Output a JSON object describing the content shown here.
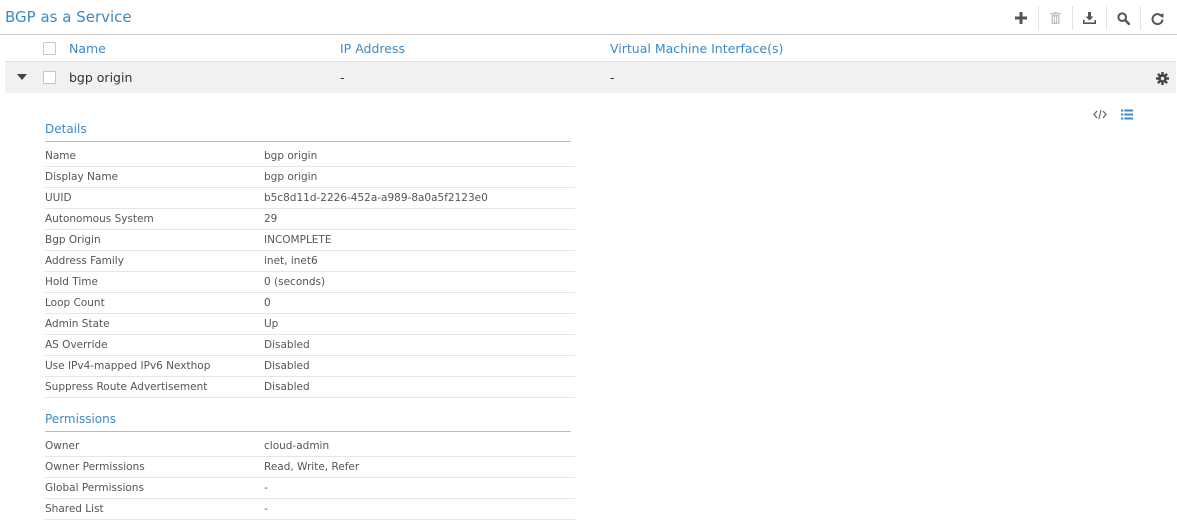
{
  "header": {
    "title": "BGP as a Service"
  },
  "toolbar": {
    "buttons": [
      {
        "name": "add",
        "icon": "plus-icon"
      },
      {
        "name": "delete",
        "icon": "trash-icon"
      },
      {
        "name": "export",
        "icon": "download-icon"
      },
      {
        "name": "search",
        "icon": "search-icon"
      },
      {
        "name": "refresh",
        "icon": "refresh-icon"
      }
    ]
  },
  "columns": {
    "name": "Name",
    "ip_address": "IP Address",
    "vmi": "Virtual Machine Interface(s)"
  },
  "row": {
    "name": "bgp origin",
    "ip_address": "-",
    "vmi": "-"
  },
  "details": {
    "title": "Details",
    "fields": [
      {
        "label": "Name",
        "value": "bgp origin"
      },
      {
        "label": "Display Name",
        "value": "bgp origin"
      },
      {
        "label": "UUID",
        "value": "b5c8d11d-2226-452a-a989-8a0a5f2123e0"
      },
      {
        "label": "Autonomous System",
        "value": "29"
      },
      {
        "label": "Bgp Origin",
        "value": "INCOMPLETE"
      },
      {
        "label": "Address Family",
        "value": "inet, inet6"
      },
      {
        "label": "Hold Time",
        "value": "0 (seconds)"
      },
      {
        "label": "Loop Count",
        "value": "0"
      },
      {
        "label": "Admin State",
        "value": "Up"
      },
      {
        "label": "AS Override",
        "value": "Disabled"
      },
      {
        "label": "Use IPv4-mapped IPv6 Nexthop",
        "value": "Disabled"
      },
      {
        "label": "Suppress Route Advertisement",
        "value": "Disabled"
      }
    ]
  },
  "permissions": {
    "title": "Permissions",
    "fields": [
      {
        "label": "Owner",
        "value": "cloud-admin"
      },
      {
        "label": "Owner Permissions",
        "value": "Read, Write, Refer"
      },
      {
        "label": "Global Permissions",
        "value": "-"
      },
      {
        "label": "Shared List",
        "value": "-"
      }
    ]
  },
  "colors": {
    "accent": "#3f89c5",
    "row_bg": "#f1f1f1"
  }
}
